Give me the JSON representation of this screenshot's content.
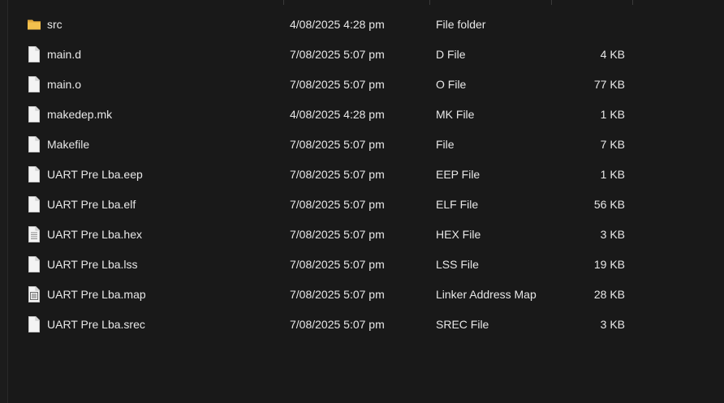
{
  "theme": {
    "background": "#191919",
    "text": "#e8e8e8",
    "folder_color": "#f3c04d"
  },
  "files": [
    {
      "name": "src",
      "date": "4/08/2025 4:28 pm",
      "type": "File folder",
      "size": "",
      "icon": "folder-icon"
    },
    {
      "name": "main.d",
      "date": "7/08/2025 5:07 pm",
      "type": "D File",
      "size": "4 KB",
      "icon": "file-icon"
    },
    {
      "name": "main.o",
      "date": "7/08/2025 5:07 pm",
      "type": "O File",
      "size": "77 KB",
      "icon": "file-icon"
    },
    {
      "name": "makedep.mk",
      "date": "4/08/2025 4:28 pm",
      "type": "MK File",
      "size": "1 KB",
      "icon": "file-icon"
    },
    {
      "name": "Makefile",
      "date": "7/08/2025 5:07 pm",
      "type": "File",
      "size": "7 KB",
      "icon": "file-icon"
    },
    {
      "name": "UART Pre Lba.eep",
      "date": "7/08/2025 5:07 pm",
      "type": "EEP File",
      "size": "1 KB",
      "icon": "file-icon"
    },
    {
      "name": "UART Pre Lba.elf",
      "date": "7/08/2025 5:07 pm",
      "type": "ELF File",
      "size": "56 KB",
      "icon": "file-icon"
    },
    {
      "name": "UART Pre Lba.hex",
      "date": "7/08/2025 5:07 pm",
      "type": "HEX File",
      "size": "3 KB",
      "icon": "text-file-icon"
    },
    {
      "name": "UART Pre Lba.lss",
      "date": "7/08/2025 5:07 pm",
      "type": "LSS File",
      "size": "19 KB",
      "icon": "file-icon"
    },
    {
      "name": "UART Pre Lba.map",
      "date": "7/08/2025 5:07 pm",
      "type": "Linker Address Map",
      "size": "28 KB",
      "icon": "map-file-icon"
    },
    {
      "name": "UART Pre Lba.srec",
      "date": "7/08/2025 5:07 pm",
      "type": "SREC File",
      "size": "3 KB",
      "icon": "file-icon"
    }
  ]
}
